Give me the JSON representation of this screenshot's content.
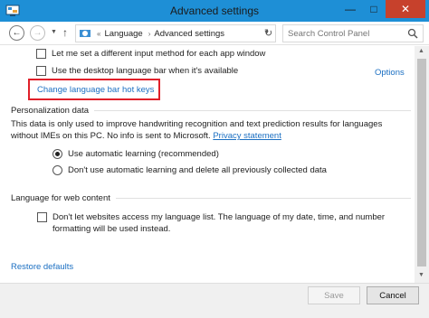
{
  "window": {
    "title": "Advanced settings"
  },
  "nav": {
    "breadcrumb": [
      "Language",
      "Advanced settings"
    ],
    "sep_glyph": "«",
    "arrow_glyph": "›",
    "search_placeholder": "Search Control Panel"
  },
  "content": {
    "opt_input_method": "Let me set a different input method for each app window",
    "opt_desktop_bar": "Use the desktop language bar when it's available",
    "options_link": "Options",
    "hotkeys_link": "Change language bar hot keys",
    "personalization": {
      "heading": "Personalization data",
      "desc": "This data is only used to improve handwriting recognition and text prediction results for languages without IMEs on this PC. No info is sent to Microsoft.",
      "privacy_link": "Privacy statement",
      "radio_auto": "Use automatic learning (recommended)",
      "radio_no_auto": "Don't use automatic learning and delete all previously collected data",
      "selected": "radio_auto"
    },
    "web": {
      "heading": "Language for web content",
      "checkbox": "Don't let websites access my language list. The language of my date, time, and number formatting will be used instead."
    },
    "restore_link": "Restore defaults"
  },
  "footer": {
    "save_label": "Save",
    "cancel_label": "Cancel"
  },
  "colors": {
    "titlebar": "#1e8fd6",
    "link": "#1b6fc2",
    "highlight_box": "#e0202a",
    "close_button": "#c7412c"
  }
}
